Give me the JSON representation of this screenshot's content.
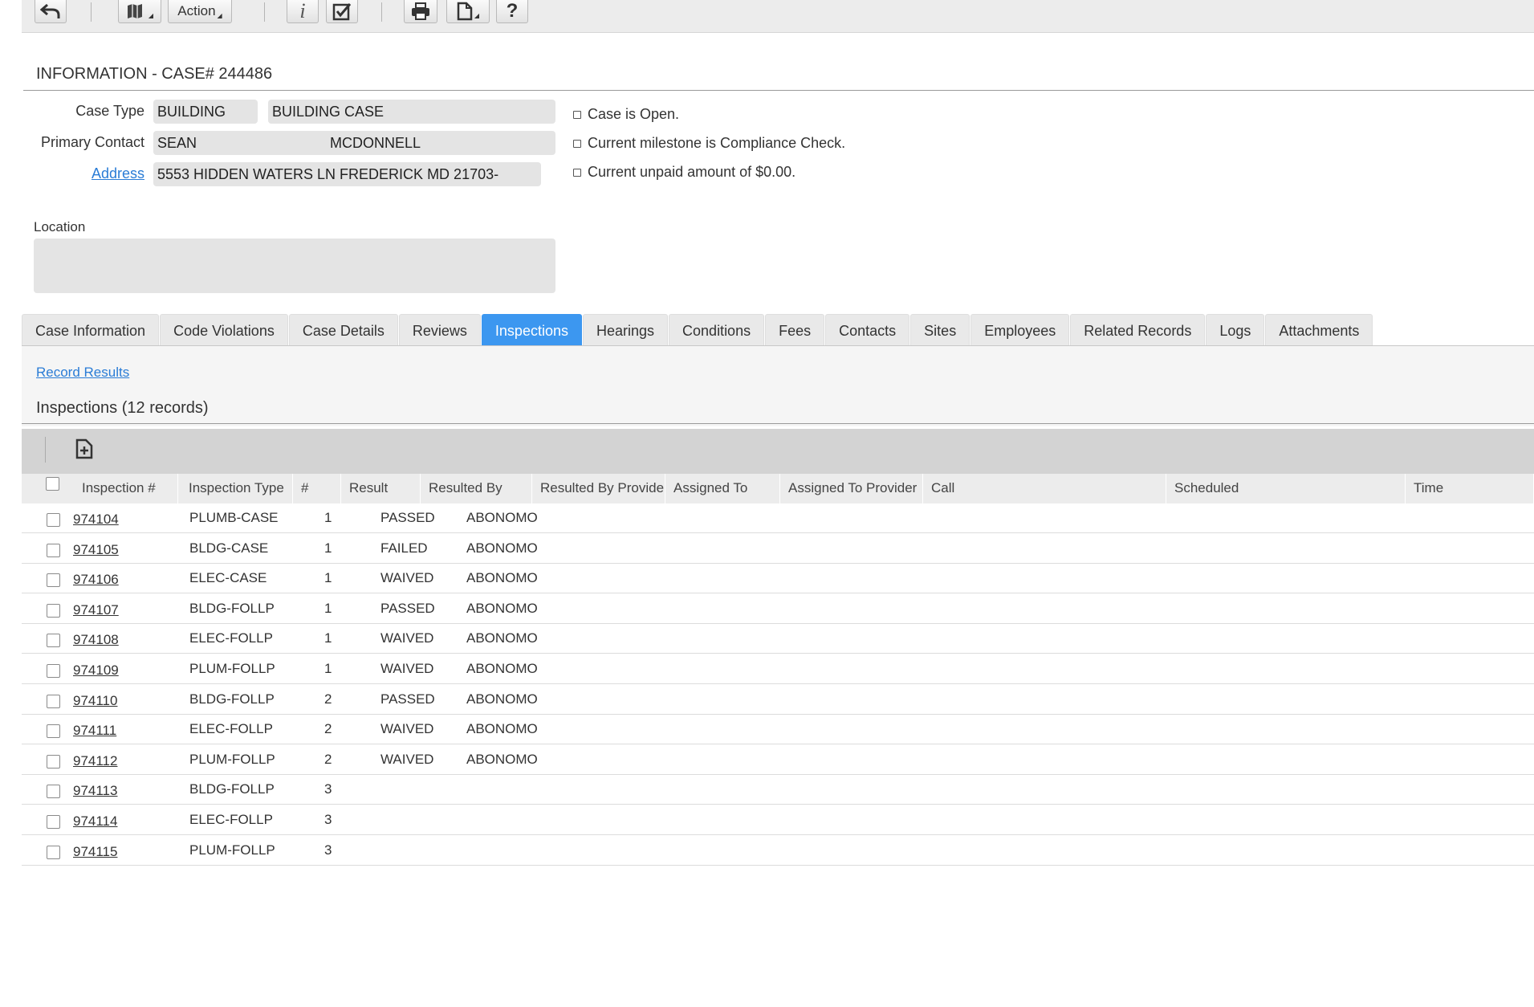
{
  "toolbar": {
    "buttons": [
      {
        "name": "back-button",
        "icon": "undo-arrow-icon"
      },
      {
        "name": "map-button",
        "icon": "map-icon"
      },
      {
        "name": "action-menu-button",
        "icon": "dropdown-icon"
      },
      {
        "name": "info-button",
        "icon": "info-icon"
      },
      {
        "name": "checklist-button",
        "icon": "checkbox-icon"
      },
      {
        "name": "print-button",
        "icon": "printer-icon"
      },
      {
        "name": "document-button",
        "icon": "document-icon"
      },
      {
        "name": "help-button",
        "icon": "question-icon"
      }
    ],
    "action_label": "Action",
    "help_glyph": "?",
    "info_glyph": "i"
  },
  "header": {
    "title": "INFORMATION - CASE# 244486"
  },
  "info": {
    "case_type_label": "Case Type",
    "case_type_code": "BUILDING",
    "case_type_desc": "BUILDING CASE",
    "primary_contact_label": "Primary Contact",
    "contact_first": "SEAN",
    "contact_last": "MCDONNELL",
    "address_label": "Address",
    "address_value": "5553 HIDDEN WATERS LN FREDERICK MD 21703-",
    "location_label": "Location",
    "location_value": ""
  },
  "status": [
    "Case is Open.",
    "Current milestone is Compliance Check.",
    "Current unpaid amount of $0.00."
  ],
  "tabs": [
    {
      "label": "Case Information",
      "active": false
    },
    {
      "label": "Code Violations",
      "active": false
    },
    {
      "label": "Case Details",
      "active": false
    },
    {
      "label": "Reviews",
      "active": false
    },
    {
      "label": "Inspections",
      "active": true
    },
    {
      "label": "Hearings",
      "active": false
    },
    {
      "label": "Conditions",
      "active": false
    },
    {
      "label": "Fees",
      "active": false
    },
    {
      "label": "Contacts",
      "active": false
    },
    {
      "label": "Sites",
      "active": false
    },
    {
      "label": "Employees",
      "active": false
    },
    {
      "label": "Related Records",
      "active": false
    },
    {
      "label": "Logs",
      "active": false
    },
    {
      "label": "Attachments",
      "active": false
    }
  ],
  "inspections": {
    "record_results_link": "Record Results",
    "title": "Inspections (12 records)",
    "columns": [
      "Inspection #",
      "Inspection Type",
      "#",
      "Result",
      "Resulted By",
      "Resulted By Provider",
      "Assigned To",
      "Assigned To Provider",
      "Call",
      "Scheduled",
      "Time"
    ],
    "rows": [
      {
        "id": "974104",
        "type": "PLUMB-CASE",
        "num": "1",
        "result": "PASSED",
        "by": "ABONOMO"
      },
      {
        "id": "974105",
        "type": "BLDG-CASE",
        "num": "1",
        "result": "FAILED",
        "by": "ABONOMO"
      },
      {
        "id": "974106",
        "type": "ELEC-CASE",
        "num": "1",
        "result": "WAIVED",
        "by": "ABONOMO"
      },
      {
        "id": "974107",
        "type": "BLDG-FOLLP",
        "num": "1",
        "result": "PASSED",
        "by": "ABONOMO"
      },
      {
        "id": "974108",
        "type": "ELEC-FOLLP",
        "num": "1",
        "result": "WAIVED",
        "by": "ABONOMO"
      },
      {
        "id": "974109",
        "type": "PLUM-FOLLP",
        "num": "1",
        "result": "WAIVED",
        "by": "ABONOMO"
      },
      {
        "id": "974110",
        "type": "BLDG-FOLLP",
        "num": "2",
        "result": "PASSED",
        "by": "ABONOMO"
      },
      {
        "id": "974111",
        "type": "ELEC-FOLLP",
        "num": "2",
        "result": "WAIVED",
        "by": "ABONOMO"
      },
      {
        "id": "974112",
        "type": "PLUM-FOLLP",
        "num": "2",
        "result": "WAIVED",
        "by": "ABONOMO"
      },
      {
        "id": "974113",
        "type": "BLDG-FOLLP",
        "num": "3",
        "result": "",
        "by": ""
      },
      {
        "id": "974114",
        "type": "ELEC-FOLLP",
        "num": "3",
        "result": "",
        "by": ""
      },
      {
        "id": "974115",
        "type": "PLUM-FOLLP",
        "num": "3",
        "result": "",
        "by": ""
      }
    ]
  },
  "colors": {
    "accent": "#3c97f0",
    "link": "#2a7cd6",
    "field_bg": "#e4e4e4"
  }
}
